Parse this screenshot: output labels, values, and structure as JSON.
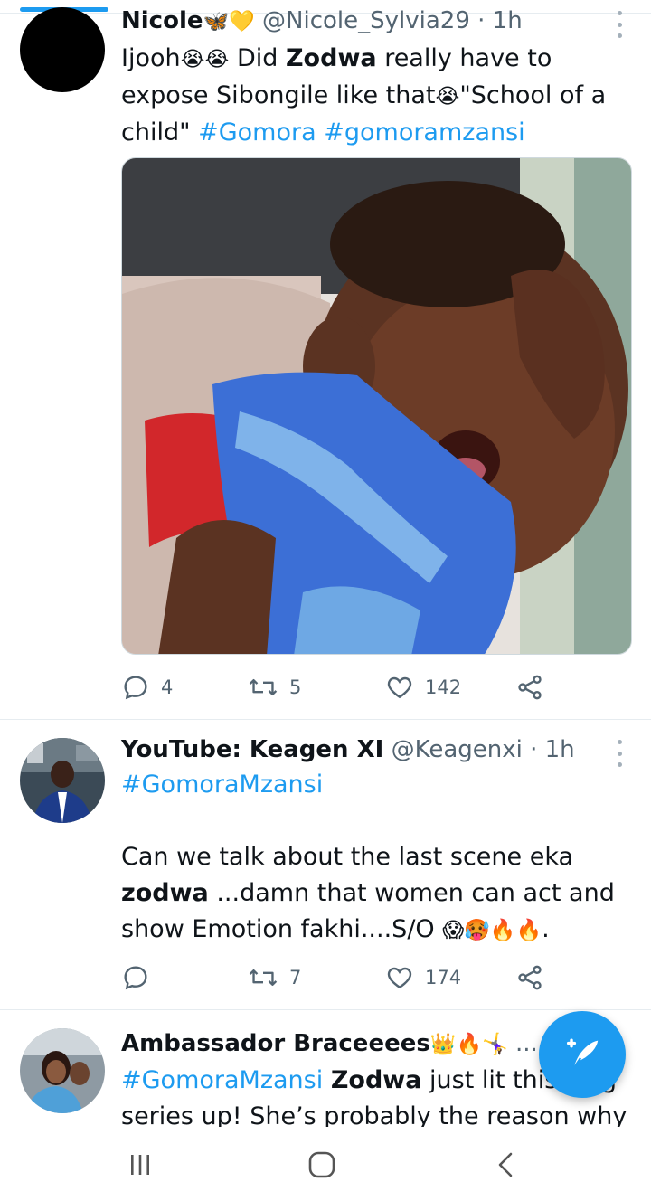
{
  "tweets": [
    {
      "name": "Nicole",
      "name_emoji": "🦋💛",
      "handle": "@Nicole_Sylvia29",
      "sep": "·",
      "time": "1h",
      "text_parts": {
        "p1": "Ijooh",
        "e1": "😭😭",
        "p2": " Did ",
        "b1": "Zodwa",
        "p3": " really have to expose Sibongile like that",
        "e2": "😭",
        "p4": "\"School of a child\" ",
        "h1": "#Gomora",
        "p5": " ",
        "h2": "#gomoramzansi"
      },
      "replies": "4",
      "retweets": "5",
      "likes": "142"
    },
    {
      "name": "YouTube: Keagen XI",
      "handle": "@Keagenxi",
      "sep": "·",
      "time": "1h",
      "hashtag": "#GomoraMzansi",
      "text_parts": {
        "p1": "Can we talk about the last scene eka ",
        "b1": "zodwa",
        "p2": " ...damn that women can act and show Emotion fakhi....S/O ",
        "e1": "😱🥵🔥🔥",
        "p3": "."
      },
      "replies": "",
      "retweets": "7",
      "likes": "174"
    },
    {
      "name": "Ambassador Braceeees",
      "name_emoji": "👑🔥🤸‍♀️",
      "trail": "...",
      "text_parts": {
        "h1": "#GomoraMzansi",
        "p1": " ",
        "b1": "Zodwa",
        "p2": " just lit this ",
        "p2b": "g",
        "p3": "series up! She’s probably the reason why"
      }
    }
  ],
  "colors": {
    "accent": "#1d9bf0",
    "text": "#0f1419",
    "secondary": "#536471",
    "divider": "#e6ecf0"
  },
  "icons": {
    "reply": "reply-icon",
    "retweet": "retweet-icon",
    "like": "heart-icon",
    "share": "share-icon",
    "compose": "compose-tweet-icon",
    "nav_recent": "recent-apps-icon",
    "nav_home": "home-icon",
    "nav_back": "back-icon"
  }
}
